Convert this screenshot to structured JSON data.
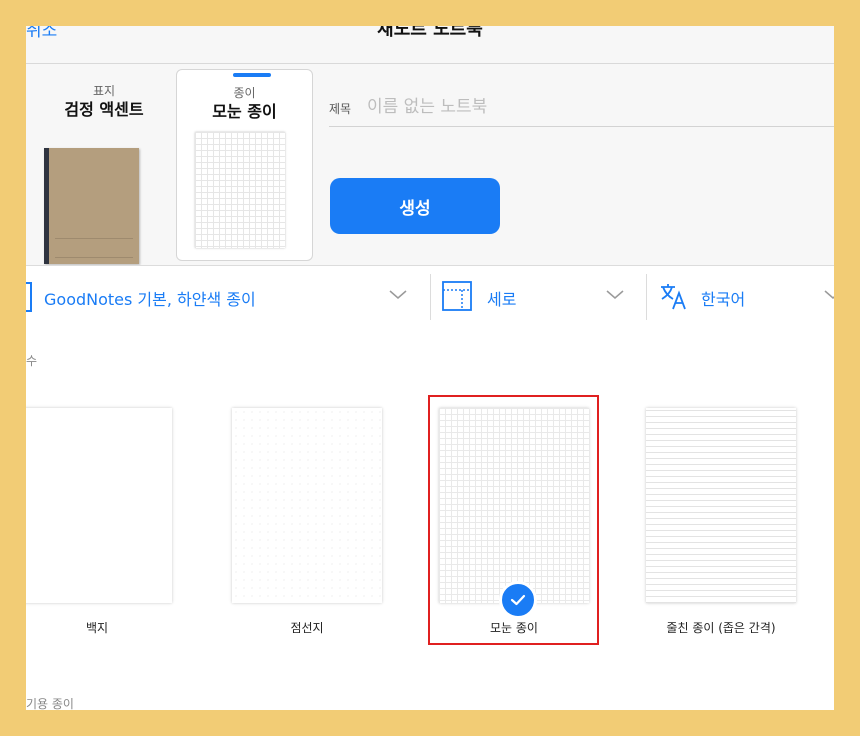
{
  "nav": {
    "cancel": "취소",
    "title": "새노트 노트북"
  },
  "cover": {
    "label": "표지",
    "name": "검정 액센트"
  },
  "paper": {
    "label": "종이",
    "name": "모눈 종이"
  },
  "title_field": {
    "label": "제목",
    "placeholder": "이름 없는 노트북",
    "value": ""
  },
  "create_button": "생성",
  "options": {
    "template": "GoodNotes 기본, 하얀색 종이",
    "orientation": "세로",
    "language": "한국어"
  },
  "section_header": "수",
  "papers": [
    {
      "label": "백지",
      "pattern": "blank",
      "selected": false
    },
    {
      "label": "점선지",
      "pattern": "dotted",
      "selected": false
    },
    {
      "label": "모눈 종이",
      "pattern": "grid",
      "selected": true
    },
    {
      "label": "줄친 종이 (좁은 간격)",
      "pattern": "ruled",
      "selected": false
    }
  ],
  "section2_header": "기용 종이",
  "colors": {
    "accent": "#1a7cf5",
    "highlight_border": "#e02020",
    "frame": "#f2cc75"
  }
}
